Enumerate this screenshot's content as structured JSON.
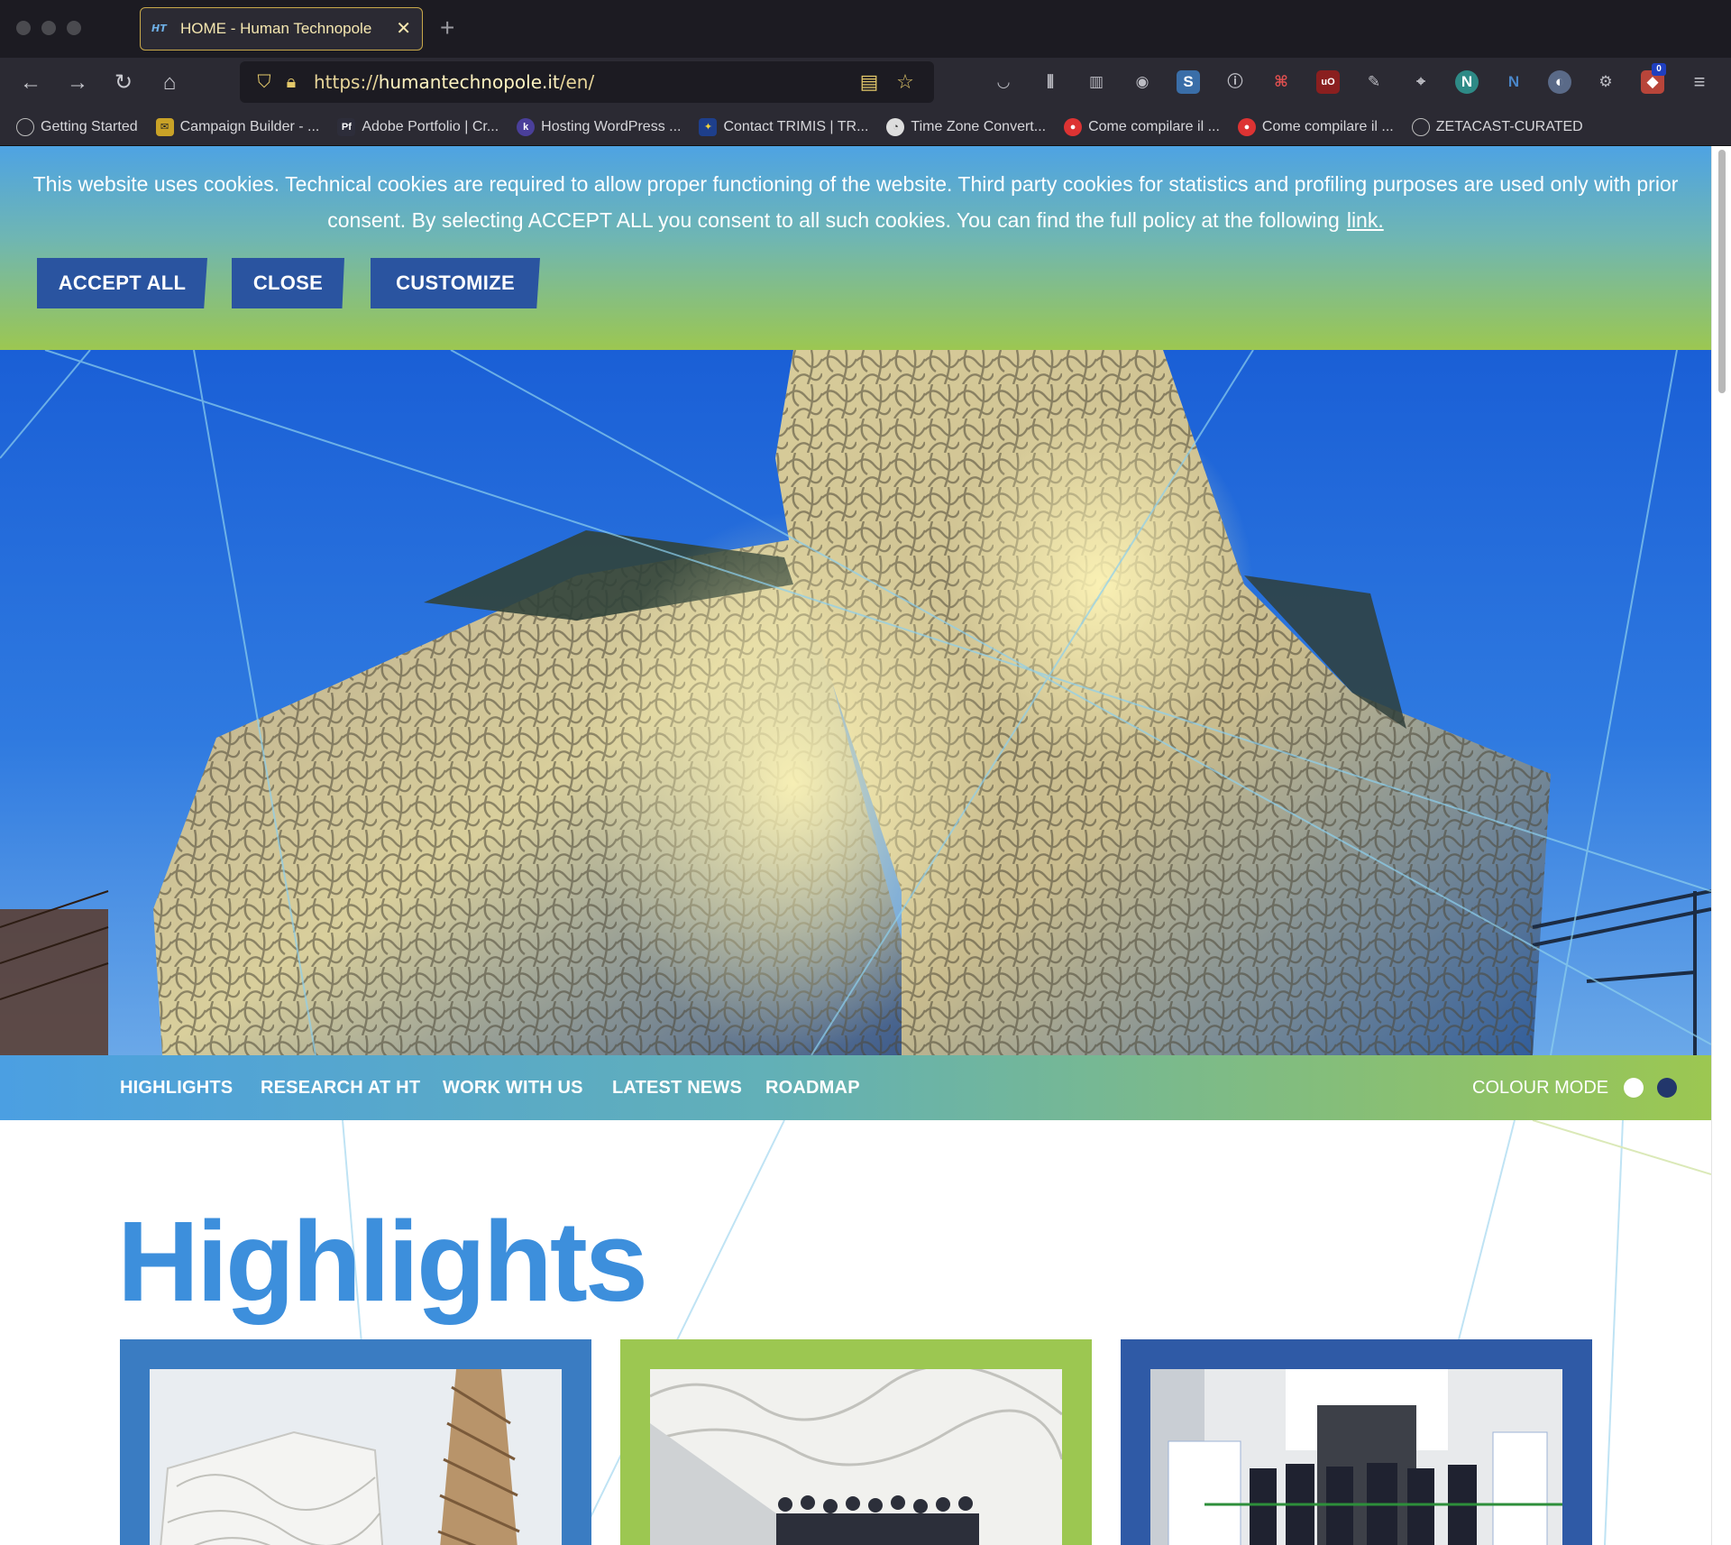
{
  "browser": {
    "tab_title": "HOME - Human Technopole",
    "tab_favicon": "HT",
    "url_prefix": "https://",
    "url_domain": "humantechnopole.it",
    "url_path": "/en/",
    "extension_badge": "0",
    "bookmarks": [
      {
        "label": "Getting Started",
        "icon": "globe-icon"
      },
      {
        "label": "Campaign Builder - ...",
        "icon": "mailchimp-icon"
      },
      {
        "label": "Adobe Portfolio | Cr...",
        "icon": "Pf"
      },
      {
        "label": "Hosting WordPress ...",
        "icon": "k"
      },
      {
        "label": "Contact TRIMIS | TR...",
        "icon": "eu-icon"
      },
      {
        "label": "Time Zone Convert...",
        "icon": "clock-icon"
      },
      {
        "label": "Come compilare il ...",
        "icon": "chrome-icon"
      },
      {
        "label": "Come compilare il ...",
        "icon": "chrome-icon"
      },
      {
        "label": "ZETACAST-CURATED",
        "icon": "globe-icon"
      }
    ]
  },
  "cookie_banner": {
    "message": "This website uses cookies. Technical cookies are required to allow proper functioning of the website. Third party cookies for statistics and profiling purposes are used only with prior consent. By selecting ACCEPT ALL you consent to all such cookies. You can find the full policy at the following",
    "link_label": "link.",
    "accept_label": "ACCEPT ALL",
    "close_label": "CLOSE",
    "customize_label": "CUSTOMIZE"
  },
  "subnav": {
    "items": [
      "HIGHLIGHTS",
      "RESEARCH AT HT",
      "WORK WITH US",
      "LATEST NEWS",
      "ROADMAP"
    ],
    "colour_mode_label": "COLOUR MODE"
  },
  "main": {
    "heading": "Highlights",
    "cards": [
      {
        "frame_color": "#3a7cc2"
      },
      {
        "frame_color": "#9cc751"
      },
      {
        "frame_color": "#2f5aa6"
      }
    ]
  },
  "colors": {
    "brand_blue": "#3d8fdc",
    "button_navy": "#2a54a0",
    "brand_green": "#9cc751"
  }
}
